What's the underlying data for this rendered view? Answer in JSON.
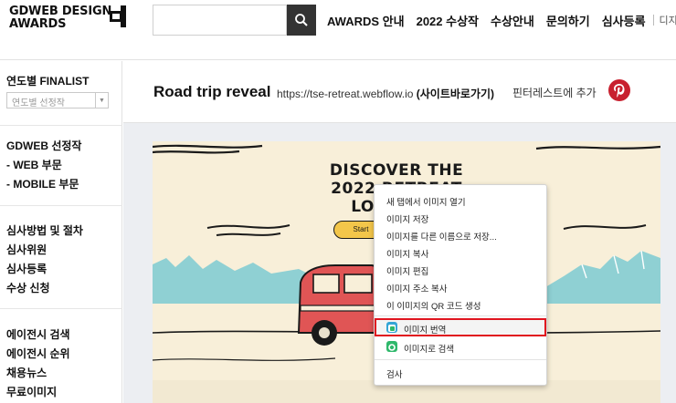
{
  "header": {
    "logo_line1": "GDWEB DESIGN",
    "logo_line2": "AWARDS",
    "search": {
      "value": "",
      "placeholder": ""
    },
    "nav": [
      "AWARDS 안내",
      "2022 수상작",
      "수상안내",
      "문의하기",
      "심사등록"
    ],
    "nav_sub": "디지털에이"
  },
  "sidebar": {
    "finalist_title": "연도별 FINALIST",
    "year_select_value": "연도별 선정작",
    "group1": [
      "GDWEB 선정작",
      "- WEB 부문",
      "- MOBILE 부문"
    ],
    "group2": [
      "심사방법 및 절차",
      "심사위원",
      "심사등록",
      "수상 신청"
    ],
    "group3": [
      "에이전시 검색",
      "에이전시 순위",
      "채용뉴스",
      "무료이미지"
    ]
  },
  "main": {
    "title": "Road trip reveal",
    "url": "https://tse-retreat.webflow.io",
    "url_link_label": "(사이트바로가기)",
    "pinterest_label": "핀터레스트에 추가"
  },
  "poster": {
    "title_line1": "DISCOVER THE",
    "title_line2": "2022 RETREAT",
    "title_line3": "LOCATION",
    "button_label": "Start"
  },
  "context_menu": {
    "items_top": [
      "새 탭에서 이미지 열기",
      "이미지 저장",
      "이미지를 다른 이름으로 저장...",
      "이미지 복사",
      "이미지 편집",
      "이미지 주소 복사",
      "이 이미지의 QR 코드 생성"
    ],
    "translate_label": "이미지 번역",
    "search_label": "이미지로 검색",
    "inspect_label": "검사"
  },
  "colors": {
    "pinterest": "#c8202f",
    "highlight_border": "#e0141e",
    "van_red": "#e05555",
    "mountain_teal": "#8fd0d3",
    "poster_bg": "#f8efd9",
    "button_yellow": "#f3c64a"
  }
}
